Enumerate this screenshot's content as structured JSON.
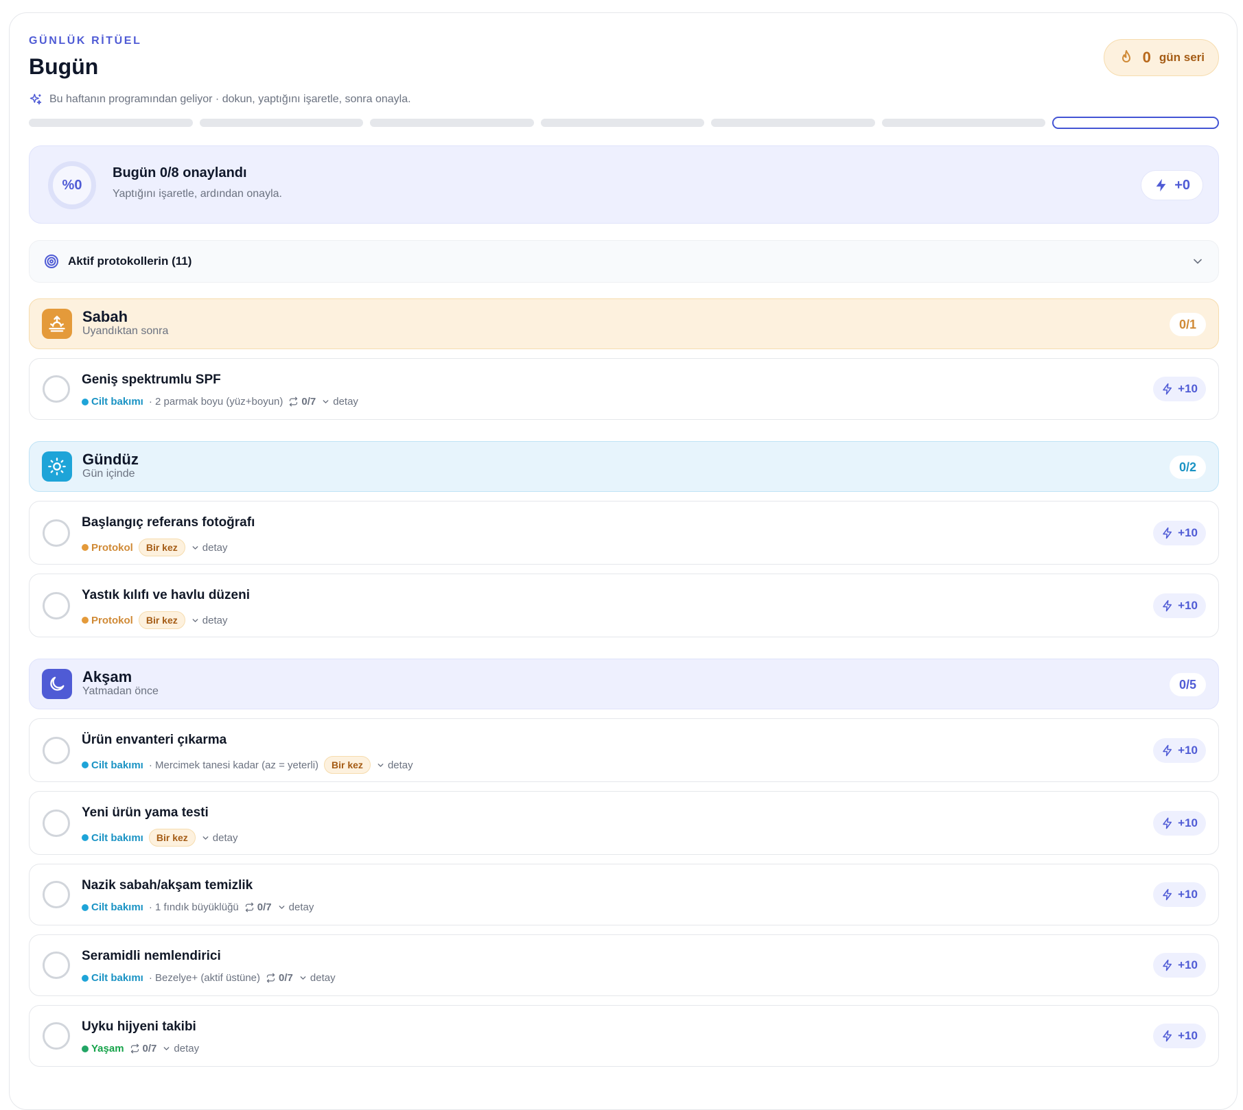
{
  "header": {
    "eyebrow": "GÜNLÜK RİTÜEL",
    "title": "Bugün",
    "subtitle": "Bu haftanın programından geliyor · dokun, yaptığını işaretle, sonra onayla."
  },
  "streak": {
    "count": "0",
    "label": "gün seri"
  },
  "week": {
    "days_total": 7,
    "active_index": 6
  },
  "summary": {
    "percent": "%0",
    "title": "Bugün 0/8 onaylandı",
    "subtitle": "Yaptığını işaretle, ardından onayla.",
    "points": "+0"
  },
  "protocols": {
    "label": "Aktif protokollerin (11)"
  },
  "sections": {
    "morning": {
      "title": "Sabah",
      "subtitle": "Uyandıktan sonra",
      "count": "0/1"
    },
    "day": {
      "title": "Gündüz",
      "subtitle": "Gün içinde",
      "count": "0/2"
    },
    "evening": {
      "title": "Akşam",
      "subtitle": "Yatmadan önce",
      "count": "0/5"
    }
  },
  "tasks": [
    {
      "title": "Geniş spektrumlu SPF",
      "category": "Cilt bakımı",
      "dose": "· 2 parmak boyu (yüz+boyun)",
      "repeat": "0/7",
      "detail": "detay",
      "xp": "+10"
    },
    {
      "title": "Başlangıç referans fotoğrafı",
      "category": "Protokol",
      "once": "Bir kez",
      "detail": "detay",
      "xp": "+10"
    },
    {
      "title": "Yastık kılıfı ve havlu düzeni",
      "category": "Protokol",
      "once": "Bir kez",
      "detail": "detay",
      "xp": "+10"
    },
    {
      "title": "Ürün envanteri çıkarma",
      "category": "Cilt bakımı",
      "dose": "· Mercimek tanesi kadar (az = yeterli)",
      "once": "Bir kez",
      "detail": "detay",
      "xp": "+10"
    },
    {
      "title": "Yeni ürün yama testi",
      "category": "Cilt bakımı",
      "once": "Bir kez",
      "detail": "detay",
      "xp": "+10"
    },
    {
      "title": "Nazik sabah/akşam temizlik",
      "category": "Cilt bakımı",
      "dose": "· 1 fındık büyüklüğü",
      "repeat": "0/7",
      "detail": "detay",
      "xp": "+10"
    },
    {
      "title": "Seramidli nemlendirici",
      "category": "Cilt bakımı",
      "dose": "· Bezelye+ (aktif üstüne)",
      "repeat": "0/7",
      "detail": "detay",
      "xp": "+10"
    },
    {
      "title": "Uyku hijyeni takibi",
      "category": "Yaşam",
      "repeat": "0/7",
      "detail": "detay",
      "xp": "+10"
    }
  ],
  "colors": {
    "accent": "#4f5bd5",
    "morning": "#e49a3a",
    "day": "#1ea4d8",
    "life": "#22a565"
  }
}
